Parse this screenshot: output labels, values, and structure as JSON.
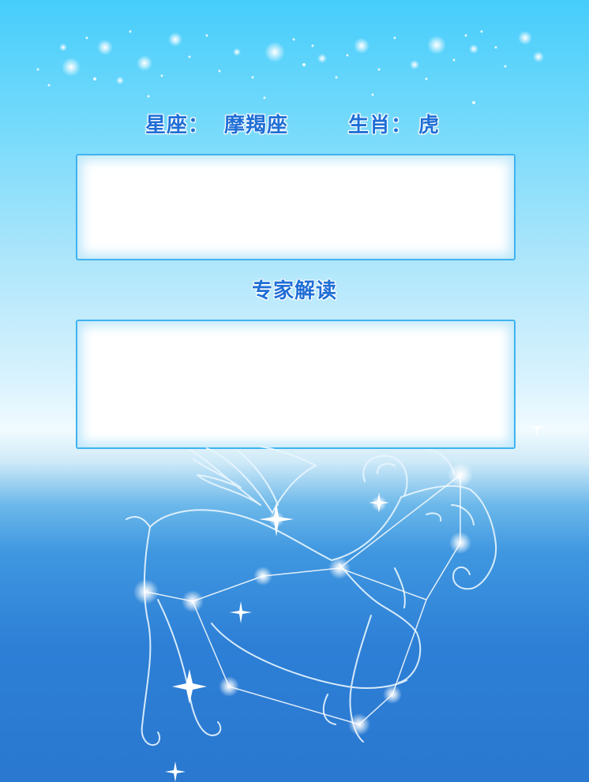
{
  "header": {
    "zodiac_label": "星座：",
    "zodiac_value": "摩羯座",
    "animal_label": "生肖：",
    "animal_value": "虎"
  },
  "panel_top": {
    "content": ""
  },
  "expert": {
    "title": "专家解读",
    "content": ""
  },
  "colors": {
    "title_blue": "#1f6ed6",
    "panel_border": "#3fb3ef",
    "sky_top": "#46cdfb",
    "sky_bottom": "#2a78d0"
  },
  "illustration": {
    "icon": "capricorn-constellation-icon"
  }
}
